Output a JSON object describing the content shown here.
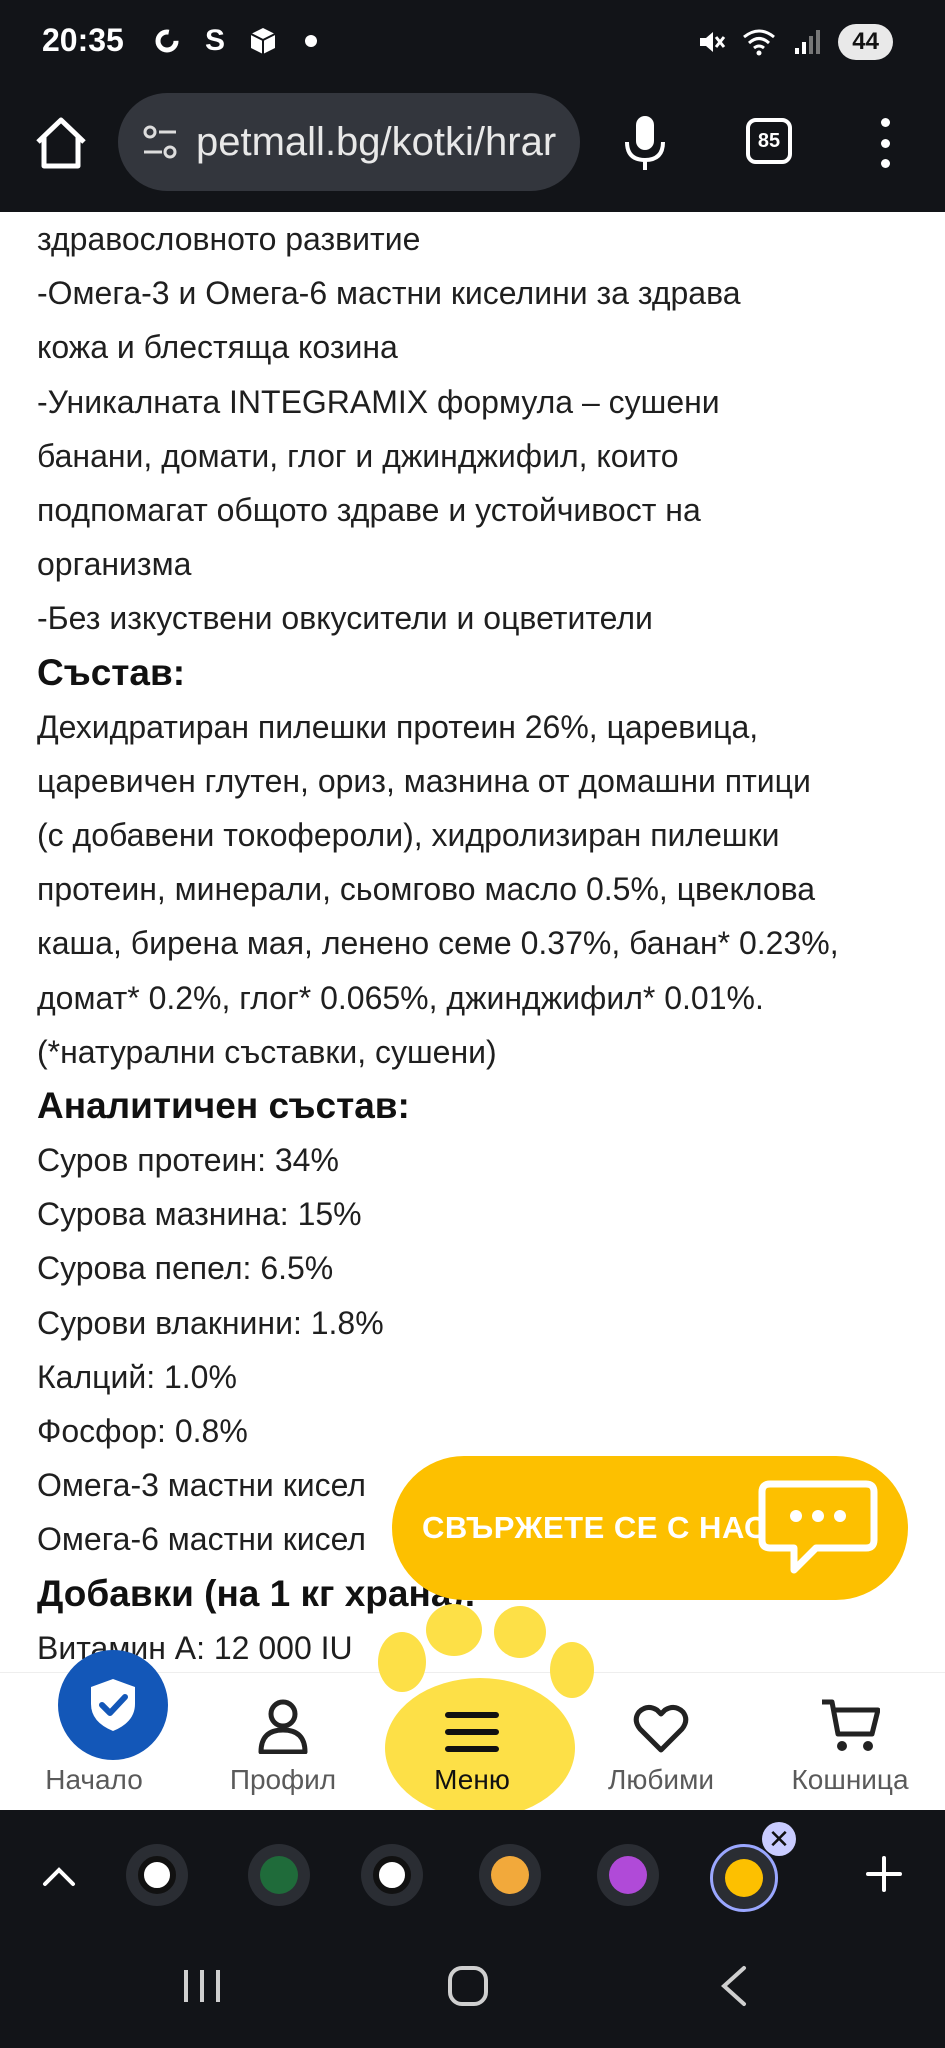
{
  "status_bar": {
    "time": "20:35",
    "icons_left": [
      "sync-icon",
      "signal-app-icon",
      "box-icon",
      "dot-icon"
    ],
    "icons_right": [
      "mute-icon",
      "wifi-icon",
      "cell-signal-icon"
    ],
    "battery": "44"
  },
  "browser": {
    "url": "petmall.bg/kotki/hrar",
    "tab_count": "85"
  },
  "content": {
    "lines": [
      "здравословното развитие",
      "-Омега-3 и Омега-6 мастни киселини за здрава",
      "кожа и блестяща козина",
      "-Уникалната INTEGRAMIX формула – сушени",
      "банани, домати, глог и джинджифил, които",
      "подпомагат общото здраве и устойчивост на",
      "организма",
      "-Без изкуствени овкусители и оцветители"
    ],
    "composition_heading": "Състав:",
    "composition_lines": [
      "Дехидратиран пилешки протеин 26%, царевица,",
      "царевичен глутен, ориз, мазнина от домашни птици",
      "(с добавени токофероли), хидролизиран пилешки",
      "протеин, минерали, сьомгово масло 0.5%, цвеклова",
      "каша, бирена мая, ленено семе 0.37%, банан* 0.23%,",
      "домат* 0.2%, глог* 0.065%, джинджифил* 0.01%.",
      "(*натурални съставки, сушени)"
    ],
    "analytical_heading": "Аналитичен състав:",
    "analytical_lines": [
      "Суров протеин: 34%",
      "Сурова мазнина: 15%",
      "Сурова пепел: 6.5%",
      "Сурови влакнини: 1.8%",
      "Калций: 1.0%",
      "Фосфор: 0.8%",
      "Омега-3 мастни кисел",
      "Омега-6 мастни кисел"
    ],
    "additives_heading": "Добавки (на 1 кг храна):",
    "additives_lines": [
      "Витамин А: 12 000 IU"
    ]
  },
  "chat_button": {
    "label": "СВЪРЖЕТЕ СЕ С НАС"
  },
  "bottom_nav": {
    "home": "Начало",
    "profile": "Профил",
    "menu": "Меню",
    "favorites": "Любими",
    "cart": "Кошница"
  },
  "colors": {
    "brand_yellow": "#fdc000",
    "shield_blue": "#1357b8",
    "dark_bar": "#121418"
  }
}
